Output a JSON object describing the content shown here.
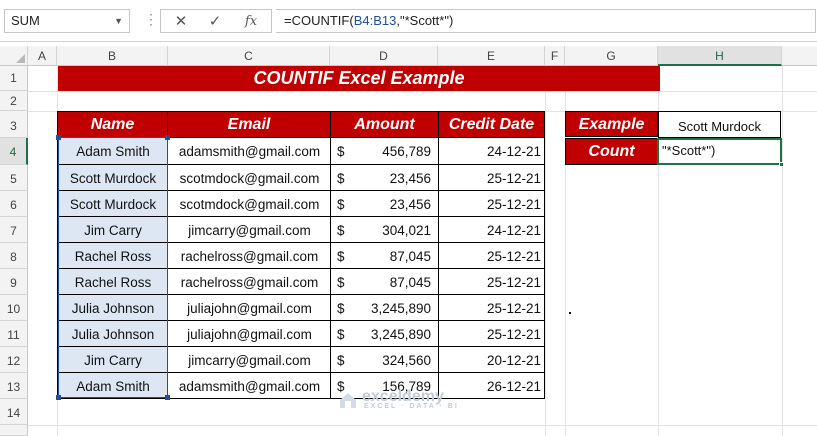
{
  "formula_bar": {
    "name_box": "SUM",
    "formula_prefix": "=COUNTIF(",
    "formula_ref": "B4:B13",
    "formula_suffix": ",\"*Scott*\")",
    "cancel_icon": "x-icon",
    "enter_icon": "check-icon",
    "fx_label": "fx"
  },
  "columns": [
    "A",
    "B",
    "C",
    "D",
    "E",
    "F",
    "G",
    "H"
  ],
  "rows": [
    "1",
    "2",
    "3",
    "4",
    "5",
    "6",
    "7",
    "8",
    "9",
    "10",
    "11",
    "12",
    "13",
    "14"
  ],
  "title": "COUNTIF Excel Example",
  "table": {
    "headers": [
      "Name",
      "Email",
      "Amount",
      "Credit Date"
    ],
    "currency_symbol": "$",
    "rows": [
      {
        "name": "Adam Smith",
        "email": "adamsmith@gmail.com",
        "amount": "456,789",
        "date": "24-12-21"
      },
      {
        "name": "Scott Murdock",
        "email": "scotmdock@gmail.com",
        "amount": "23,456",
        "date": "25-12-21"
      },
      {
        "name": "Scott Murdock",
        "email": "scotmdock@gmail.com",
        "amount": "23,456",
        "date": "25-12-21"
      },
      {
        "name": "Jim Carry",
        "email": "jimcarry@gmail.com",
        "amount": "304,021",
        "date": "24-12-21"
      },
      {
        "name": "Rachel Ross",
        "email": "rachelross@gmail.com",
        "amount": "87,045",
        "date": "25-12-21"
      },
      {
        "name": "Rachel Ross",
        "email": "rachelross@gmail.com",
        "amount": "87,045",
        "date": "25-12-21"
      },
      {
        "name": "Julia Johnson",
        "email": "juliajohn@gmail.com",
        "amount": "3,245,890",
        "date": "25-12-21"
      },
      {
        "name": "Julia Johnson",
        "email": "juliajohn@gmail.com",
        "amount": "3,245,890",
        "date": "25-12-21"
      },
      {
        "name": "Jim Carry",
        "email": "jimcarry@gmail.com",
        "amount": "324,560",
        "date": "20-12-21"
      },
      {
        "name": "Adam Smith",
        "email": "adamsmith@gmail.com",
        "amount": "156,789",
        "date": "26-12-21"
      }
    ]
  },
  "example_box": {
    "example_label": "Example",
    "example_value": "Scott Murdock",
    "count_label": "Count",
    "count_editing_text": "\"*Scott*\")"
  },
  "watermark": {
    "brand": "exceldemy",
    "tagline": "EXCEL · DATA · BI"
  },
  "colors": {
    "header_red": "#c00000",
    "name_fill": "#dde7f4",
    "selection_green": "#1e7145",
    "range_blue": "#1f4e9a"
  }
}
